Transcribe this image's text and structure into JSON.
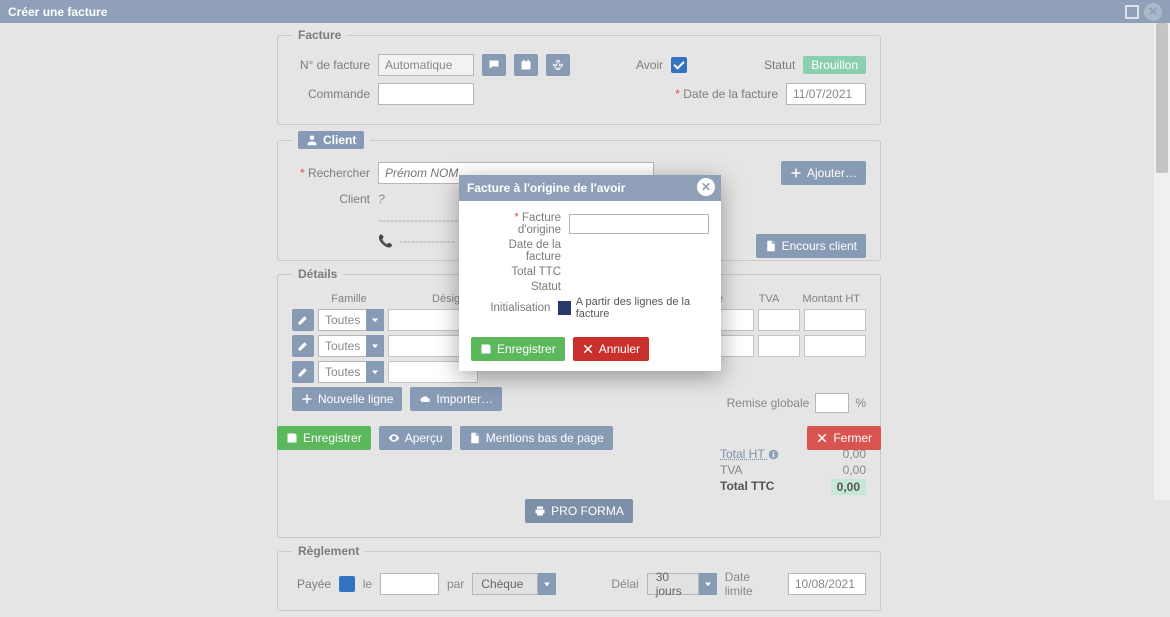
{
  "window": {
    "title": "Créer une facture"
  },
  "facture": {
    "legend": "Facture",
    "numero_label": "N° de facture",
    "numero_value": "Automatique",
    "commande_label": "Commande",
    "avoir_label": "Avoir",
    "statut_label": "Statut",
    "statut_value": "Brouillon",
    "date_label": "Date de la facture",
    "date_value": "11/07/2021"
  },
  "client": {
    "legend": "Client",
    "rechercher_label": "Rechercher",
    "rechercher_placeholder": "Prénom NOM",
    "ajouter_btn": "Ajouter…",
    "client_label": "Client",
    "client_value": "?",
    "encours_btn": "Encours client"
  },
  "details": {
    "legend": "Détails",
    "headers": {
      "famille": "Famille",
      "designation": "Désignation",
      "qte": "Qté",
      "tva": "TVA",
      "montant": "Montant HT"
    },
    "famille_value": "Toutes",
    "nouvelle_ligne": "Nouvelle ligne",
    "importer": "Importer…",
    "remise_label": "Remise globale",
    "pct": "%",
    "proforma": "PRO FORMA",
    "total_ht_label": "Total HT",
    "total_ht_val": "0,00",
    "tva_label": "TVA",
    "tva_val": "0,00",
    "total_ttc_label": "Total TTC",
    "total_ttc_val": "0,00"
  },
  "reglement": {
    "legend": "Règlement",
    "payee_label": "Payée",
    "le_label": "le",
    "par_label": "par",
    "mode_value": "Chèque",
    "delai_label": "Délai",
    "delai_value": "30 jours",
    "date_limite_label": "Date limite",
    "date_limite_value": "10/08/2021"
  },
  "footer": {
    "enregistrer": "Enregistrer",
    "apercu": "Aperçu",
    "mentions": "Mentions bas de page",
    "fermer": "Fermer"
  },
  "modal": {
    "title": "Facture à l'origine de l'avoir",
    "facture_origine": "Facture d'origine",
    "date_facture": "Date de la facture",
    "total_ttc": "Total TTC",
    "statut": "Statut",
    "initialisation": "Initialisation",
    "init_text": "A partir des lignes de la facture",
    "enregistrer": "Enregistrer",
    "annuler": "Annuler"
  },
  "dashes": "------------------------",
  "dashes2": "--------------"
}
